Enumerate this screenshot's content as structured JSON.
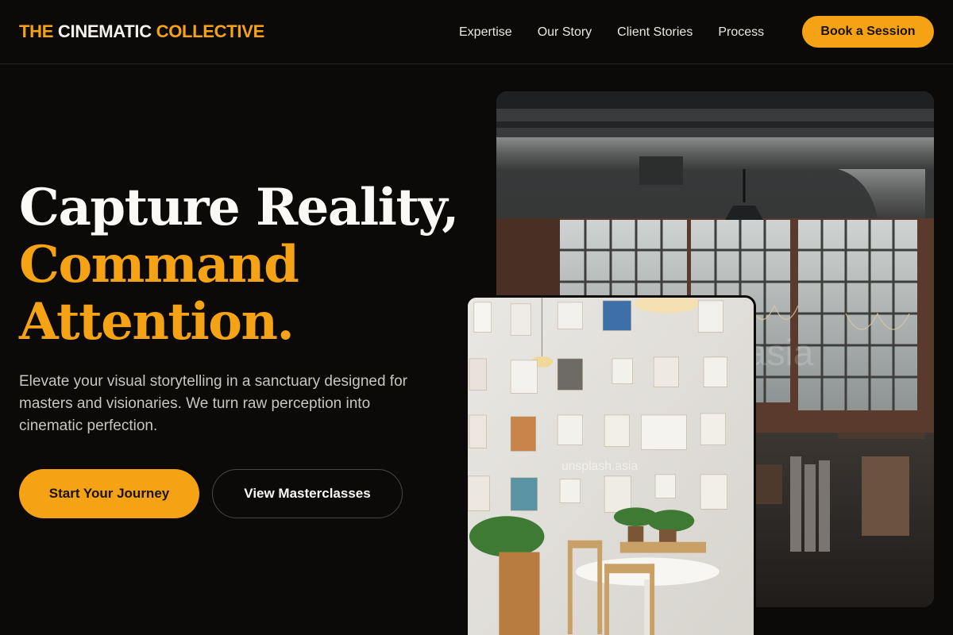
{
  "brand": {
    "part1": "THE",
    "part2": "CINEMATIC",
    "part3": "COLLECTIVE",
    "accent_color": "#f5a214"
  },
  "nav": {
    "items": [
      {
        "label": "Expertise"
      },
      {
        "label": "Our Story"
      },
      {
        "label": "Client Stories"
      },
      {
        "label": "Process"
      }
    ],
    "cta_label": "Book a Session"
  },
  "hero": {
    "headline_line1": "Capture Reality,",
    "headline_line2": "Command",
    "headline_line3": "Attention.",
    "description": "Elevate your visual storytelling in a sanctuary designed for masters and visionaries. We turn raw perception into cinematic perfection.",
    "primary_button": "Start Your Journey",
    "secondary_button": "View Masterclasses"
  },
  "images": {
    "back": {
      "name": "industrial-loft-photo",
      "watermark": "asia"
    },
    "front": {
      "name": "studio-wall-photo",
      "watermark": "unsplash.asia"
    }
  }
}
